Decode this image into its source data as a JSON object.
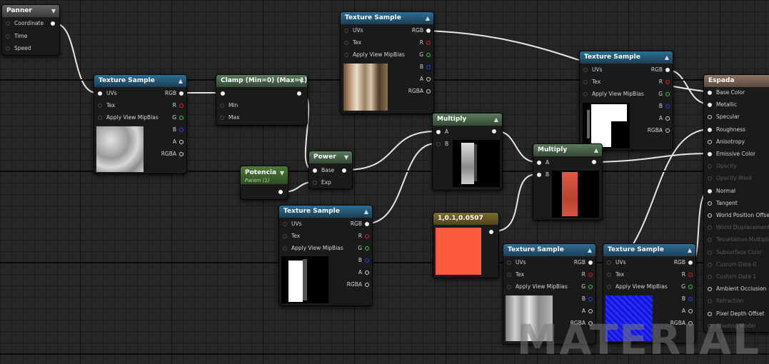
{
  "nodes": {
    "panner": {
      "title": "Panner",
      "pins": {
        "coordinate": "Coordinate",
        "time": "Time",
        "speed": "Speed"
      }
    },
    "tex1": {
      "title": "Texture Sample",
      "pins": {
        "uvs": "UVs",
        "tex": "Tex",
        "mip": "Apply View MipBias",
        "rgb": "RGB",
        "r": "R",
        "g": "G",
        "b": "B",
        "a": "A",
        "rgba": "RGBA"
      }
    },
    "clamp": {
      "title": "Clamp (Min=0) (Max=1)",
      "pins": {
        "min": "Min",
        "max": "Max"
      }
    },
    "tex2": {
      "title": "Texture Sample",
      "pins": {
        "uvs": "UVs",
        "tex": "Tex",
        "mip": "Apply View MipBias",
        "rgb": "RGB",
        "r": "R",
        "g": "G",
        "b": "B",
        "a": "A",
        "rgba": "RGBA"
      }
    },
    "potencia": {
      "title": "Potencia",
      "subtitle": "Param (1)"
    },
    "power": {
      "title": "Power",
      "pins": {
        "base": "Base",
        "exp": "Exp"
      }
    },
    "multiply1": {
      "title": "Multiply",
      "pins": {
        "a": "A",
        "b": "B"
      }
    },
    "tex3": {
      "title": "Texture Sample",
      "pins": {
        "uvs": "UVs",
        "tex": "Tex",
        "mip": "Apply View MipBias",
        "rgb": "RGB",
        "r": "R",
        "g": "G",
        "b": "B",
        "a": "A",
        "rgba": "RGBA"
      }
    },
    "const": {
      "title": "1,0.1,0.0507",
      "color": "#ff5a3f"
    },
    "tex4": {
      "title": "Texture Sample",
      "pins": {
        "uvs": "UVs",
        "tex": "Tex",
        "mip": "Apply View MipBias",
        "rgb": "RGB",
        "r": "R",
        "g": "G",
        "b": "B",
        "a": "A",
        "rgba": "RGBA"
      }
    },
    "multiply2": {
      "title": "Multiply",
      "pins": {
        "a": "A",
        "b": "B"
      }
    },
    "tex5": {
      "title": "Texture Sample",
      "pins": {
        "uvs": "UVs",
        "tex": "Tex",
        "mip": "Apply View MipBias",
        "rgb": "RGB",
        "r": "R",
        "g": "G",
        "b": "B",
        "a": "A",
        "rgba": "RGBA"
      }
    },
    "tex6": {
      "title": "Texture Sample",
      "pins": {
        "uvs": "UVs",
        "tex": "Tex",
        "mip": "Apply View MipBias",
        "rgb": "RGB",
        "r": "R",
        "g": "G",
        "b": "B",
        "a": "A",
        "rgba": "RGBA"
      }
    },
    "espada": {
      "title": "Espada",
      "inputs": [
        "Base Color",
        "Metallic",
        "Specular",
        "Roughness",
        "Anisotropy",
        "Emissive Color",
        "Opacity",
        "Opacity Mask",
        "Normal",
        "Tangent",
        "World Position Offset",
        "World Displacement",
        "Tessellation Multiplier",
        "Subsurface Color",
        "Custom Data 0",
        "Custom Data 1",
        "Ambient Occlusion",
        "Refraction",
        "Pixel Depth Offset",
        "Shading Model"
      ]
    }
  },
  "watermark": "MATERIAL",
  "colors": {
    "wire": "#e8e8e8",
    "pin_r": "#e02020",
    "pin_g": "#2ed12e",
    "pin_b": "#2f3cf0",
    "constant": "#ff5a3f"
  }
}
